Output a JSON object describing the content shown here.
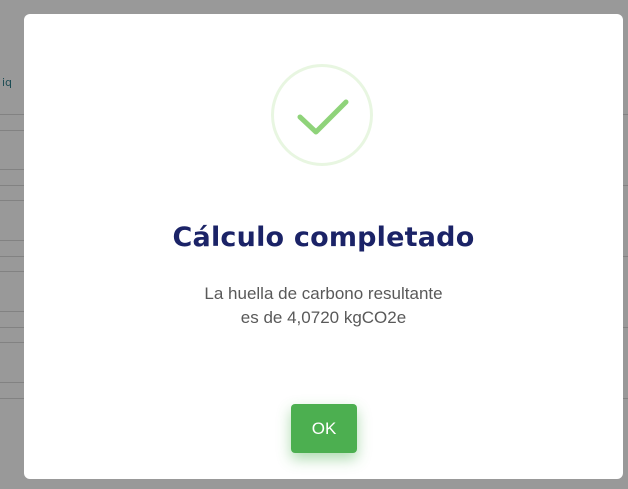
{
  "background": {
    "partial_text": "iq"
  },
  "dialog": {
    "title": "Cálculo completado",
    "message_line1": "La huella de carbono resultante",
    "message_line2": "es de 4,0720 kgCO2e",
    "ok_label": "OK",
    "icon": "check-icon"
  },
  "colors": {
    "title": "#1b2367",
    "success": "#4caf50",
    "check": "#8fd37a",
    "message": "#595959"
  }
}
